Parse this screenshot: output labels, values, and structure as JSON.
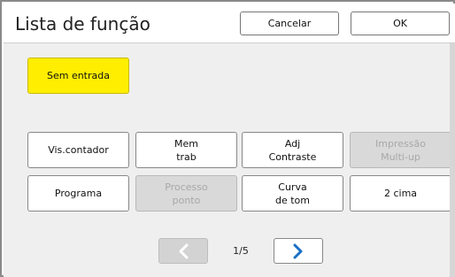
{
  "header": {
    "title": "Lista de função",
    "cancel_label": "Cancelar",
    "ok_label": "OK"
  },
  "input_button": {
    "label": "Sem entrada",
    "color": "#ffee00"
  },
  "functions": {
    "row1": [
      {
        "label": "Vis.contador",
        "enabled": true
      },
      {
        "label": "Mem\ntrab",
        "enabled": true
      },
      {
        "label": "Adj\nContraste",
        "enabled": true
      },
      {
        "label": "Impressão\nMulti-up",
        "enabled": false
      }
    ],
    "row2": [
      {
        "label": "Programa",
        "enabled": true
      },
      {
        "label": "Processo\nponto",
        "enabled": false
      },
      {
        "label": "Curva\nde tom",
        "enabled": true
      },
      {
        "label": "2 cima",
        "enabled": true
      }
    ]
  },
  "pagination": {
    "indicator": "1/5",
    "prev_icon": "chevron-left-icon",
    "next_icon": "chevron-right-icon",
    "prev_enabled": false,
    "next_enabled": true,
    "accent_color": "#1a6fc4"
  }
}
